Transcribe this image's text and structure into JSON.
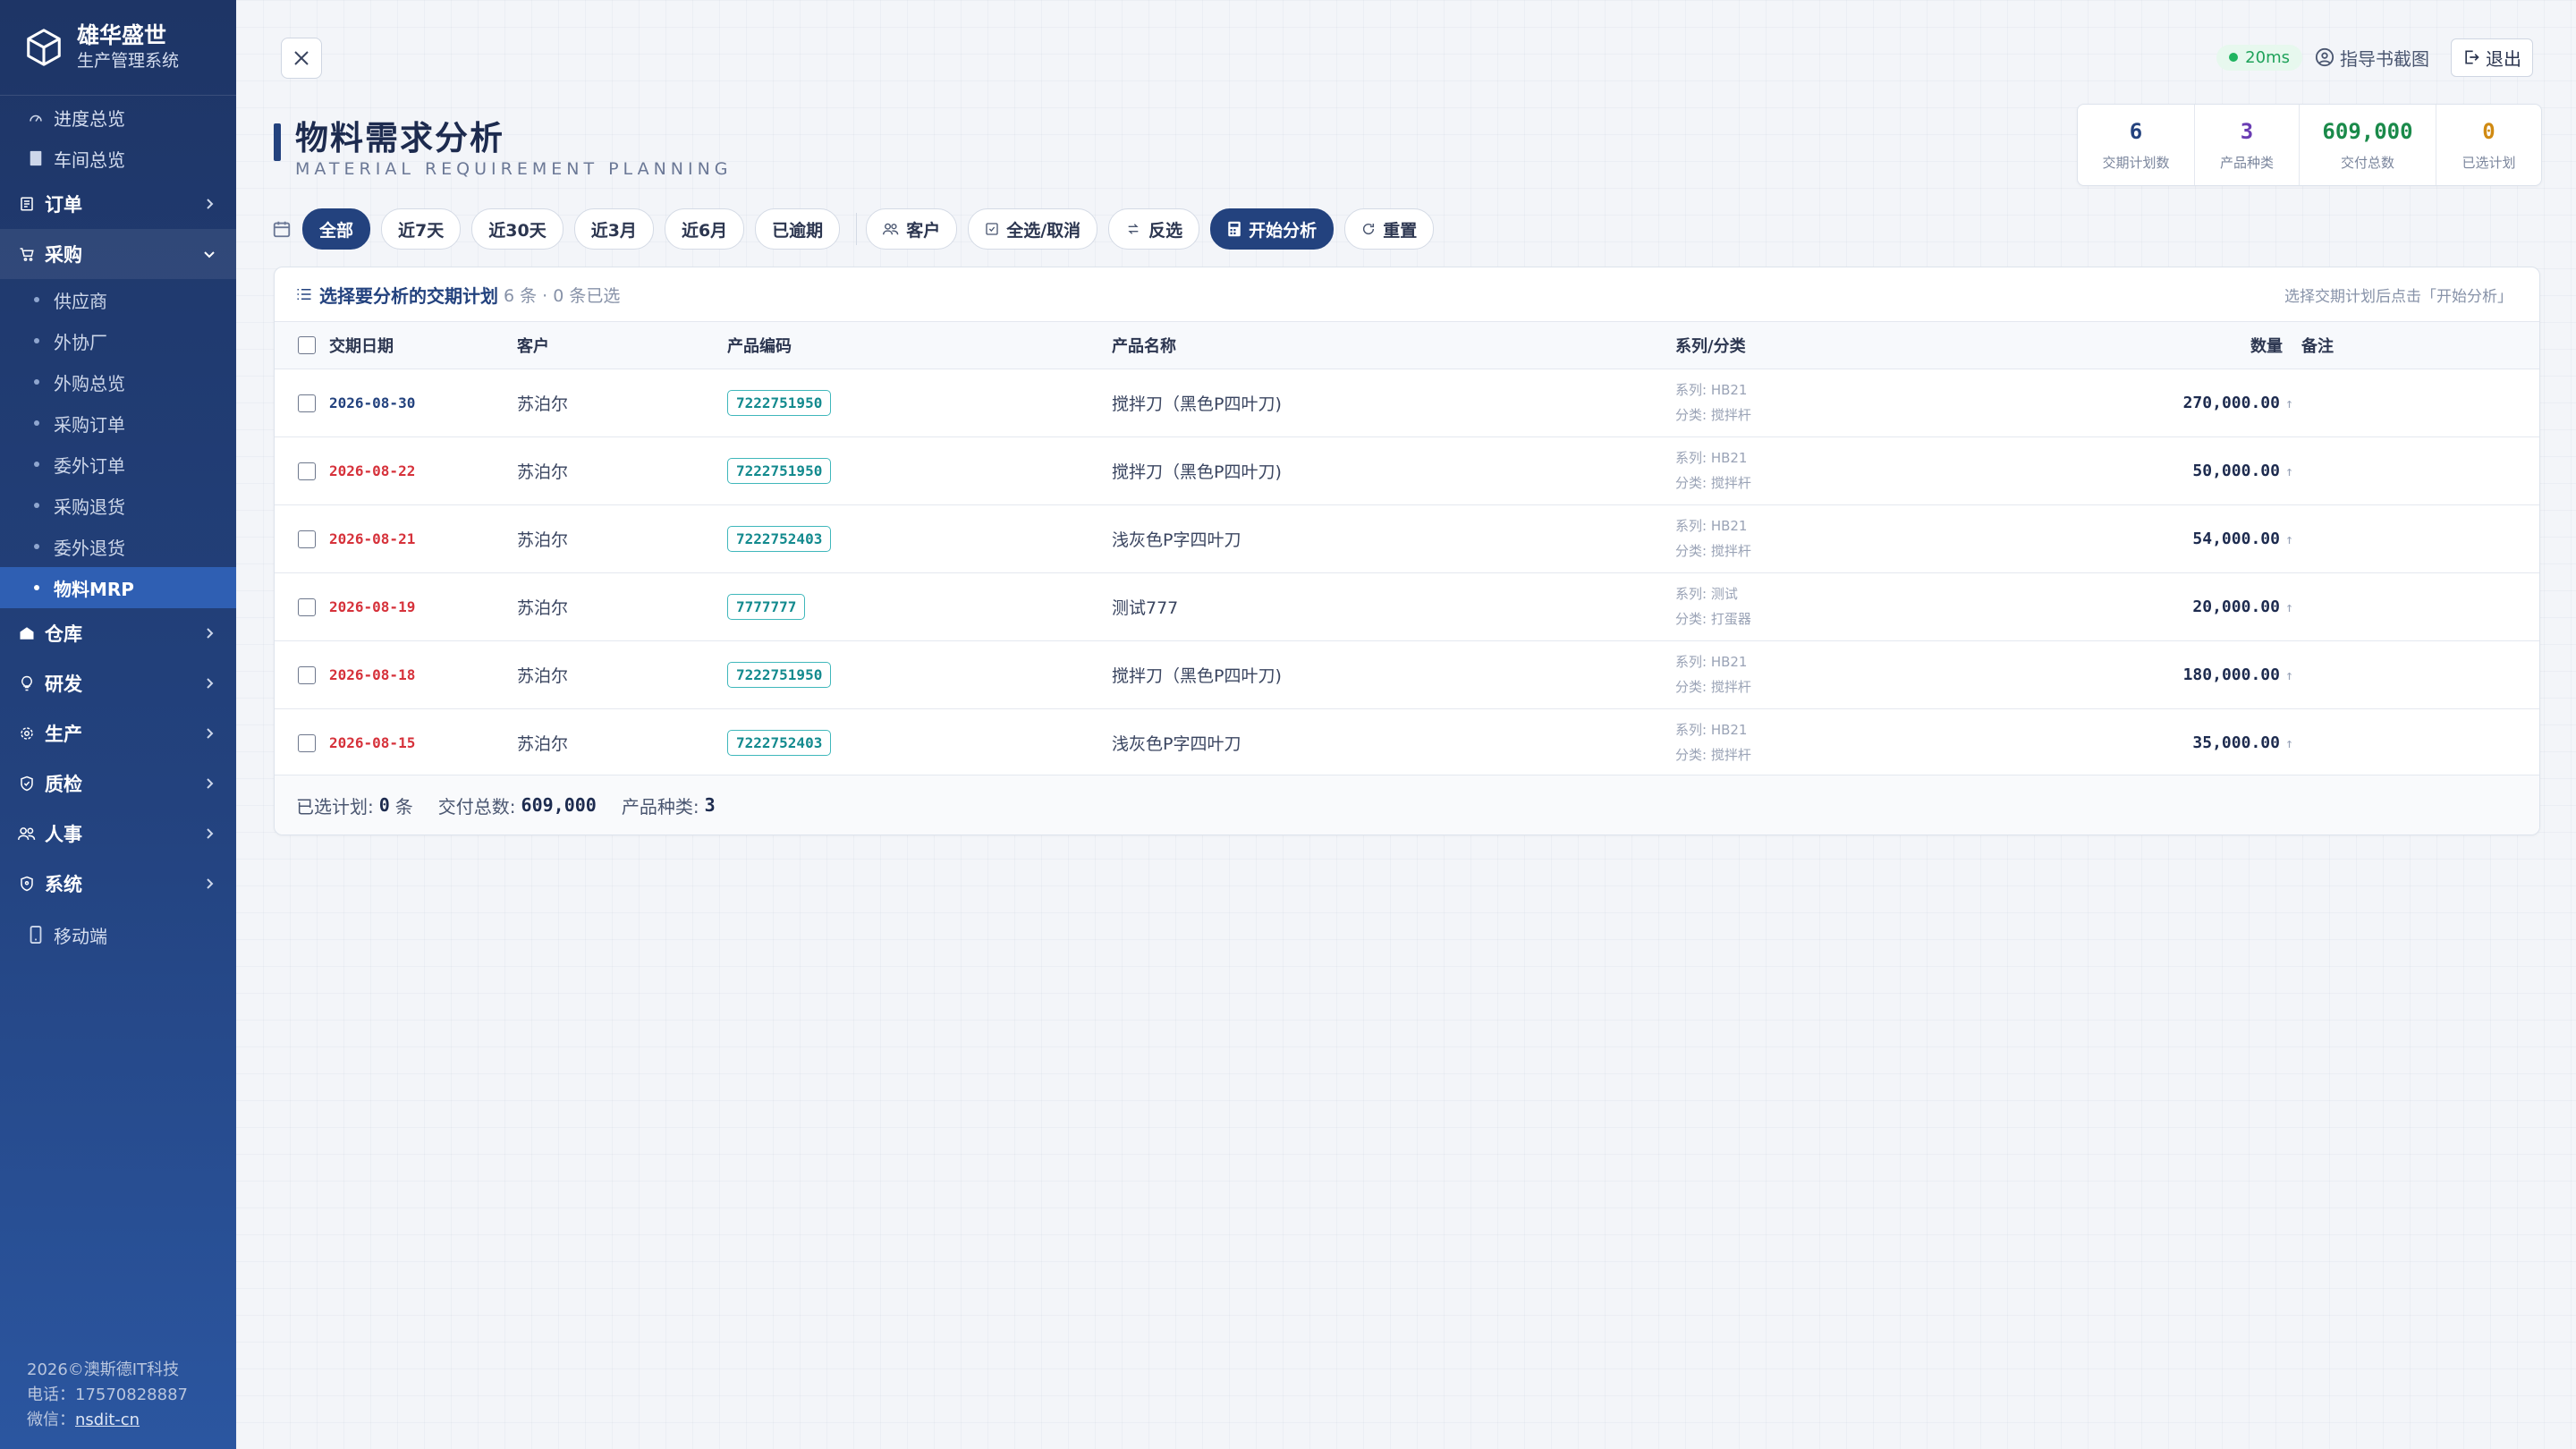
{
  "brand": {
    "title": "雄华盛世",
    "subtitle": "生产管理系统"
  },
  "nav": {
    "items": [
      {
        "label": "进度总览"
      },
      {
        "label": "车间总览"
      },
      {
        "label": "订单"
      },
      {
        "label": "采购"
      },
      {
        "label": "仓库"
      },
      {
        "label": "研发"
      },
      {
        "label": "生产"
      },
      {
        "label": "质检"
      },
      {
        "label": "人事"
      },
      {
        "label": "系统"
      },
      {
        "label": "移动端"
      }
    ],
    "purchase_sub": [
      {
        "label": "供应商"
      },
      {
        "label": "外协厂"
      },
      {
        "label": "外购总览"
      },
      {
        "label": "采购订单"
      },
      {
        "label": "委外订单"
      },
      {
        "label": "采购退货"
      },
      {
        "label": "委外退货"
      },
      {
        "label": "物料MRP"
      }
    ]
  },
  "footer": {
    "copyright": "2026©澳斯德IT科技",
    "phone": "电话：17570828887",
    "wechat_label": "微信：",
    "wechat": "nsdit-cn"
  },
  "topbar": {
    "ping": "20ms",
    "guide": "指导书截图",
    "logout": "退出"
  },
  "page": {
    "title": "物料需求分析",
    "subtitle": "MATERIAL REQUIREMENT PLANNING"
  },
  "stats": [
    {
      "value": "6",
      "label": "交期计划数",
      "color": "#23427e"
    },
    {
      "value": "3",
      "label": "产品种类",
      "color": "#6a3db3"
    },
    {
      "value": "609,000",
      "label": "交付总数",
      "color": "#1a8a4a"
    },
    {
      "value": "0",
      "label": "已选计划",
      "color": "#d08a12"
    }
  ],
  "filters": {
    "ranges": [
      "全部",
      "近7天",
      "近30天",
      "近3月",
      "近6月",
      "已逾期"
    ],
    "customer": "客户",
    "select_all": "全选/取消",
    "invert": "反选",
    "analyze": "开始分析",
    "reset": "重置"
  },
  "card": {
    "title": "选择要分析的交期计划",
    "count": "6 条 · 0 条已选",
    "hint": "选择交期计划后点击「开始分析」",
    "columns": [
      "交期日期",
      "客户",
      "产品编码",
      "产品名称",
      "系列/分类",
      "数量",
      "备注"
    ],
    "rows": [
      {
        "date": "2026-08-30",
        "overdue": false,
        "customer": "苏泊尔",
        "code": "7222751950",
        "name": "搅拌刀（黑色P四叶刀)",
        "series": "系列: HB21",
        "category": "分类: 搅拌杆",
        "qty": "270,000.00",
        "note": ""
      },
      {
        "date": "2026-08-22",
        "overdue": true,
        "customer": "苏泊尔",
        "code": "7222751950",
        "name": "搅拌刀（黑色P四叶刀)",
        "series": "系列: HB21",
        "category": "分类: 搅拌杆",
        "qty": "50,000.00",
        "note": ""
      },
      {
        "date": "2026-08-21",
        "overdue": true,
        "customer": "苏泊尔",
        "code": "7222752403",
        "name": "浅灰色P字四叶刀",
        "series": "系列: HB21",
        "category": "分类: 搅拌杆",
        "qty": "54,000.00",
        "note": ""
      },
      {
        "date": "2026-08-19",
        "overdue": true,
        "customer": "苏泊尔",
        "code": "7777777",
        "name": "测试777",
        "series": "系列: 测试",
        "category": "分类: 打蛋器",
        "qty": "20,000.00",
        "note": ""
      },
      {
        "date": "2026-08-18",
        "overdue": true,
        "customer": "苏泊尔",
        "code": "7222751950",
        "name": "搅拌刀（黑色P四叶刀)",
        "series": "系列: HB21",
        "category": "分类: 搅拌杆",
        "qty": "180,000.00",
        "note": ""
      },
      {
        "date": "2026-08-15",
        "overdue": true,
        "customer": "苏泊尔",
        "code": "7222752403",
        "name": "浅灰色P字四叶刀",
        "series": "系列: HB21",
        "category": "分类: 搅拌杆",
        "qty": "35,000.00",
        "note": ""
      }
    ],
    "footer": {
      "selected_label": "已选计划:",
      "selected": "0",
      "selected_unit": "条",
      "total_label": "交付总数:",
      "total": "609,000",
      "kinds_label": "产品种类:",
      "kinds": "3"
    }
  }
}
